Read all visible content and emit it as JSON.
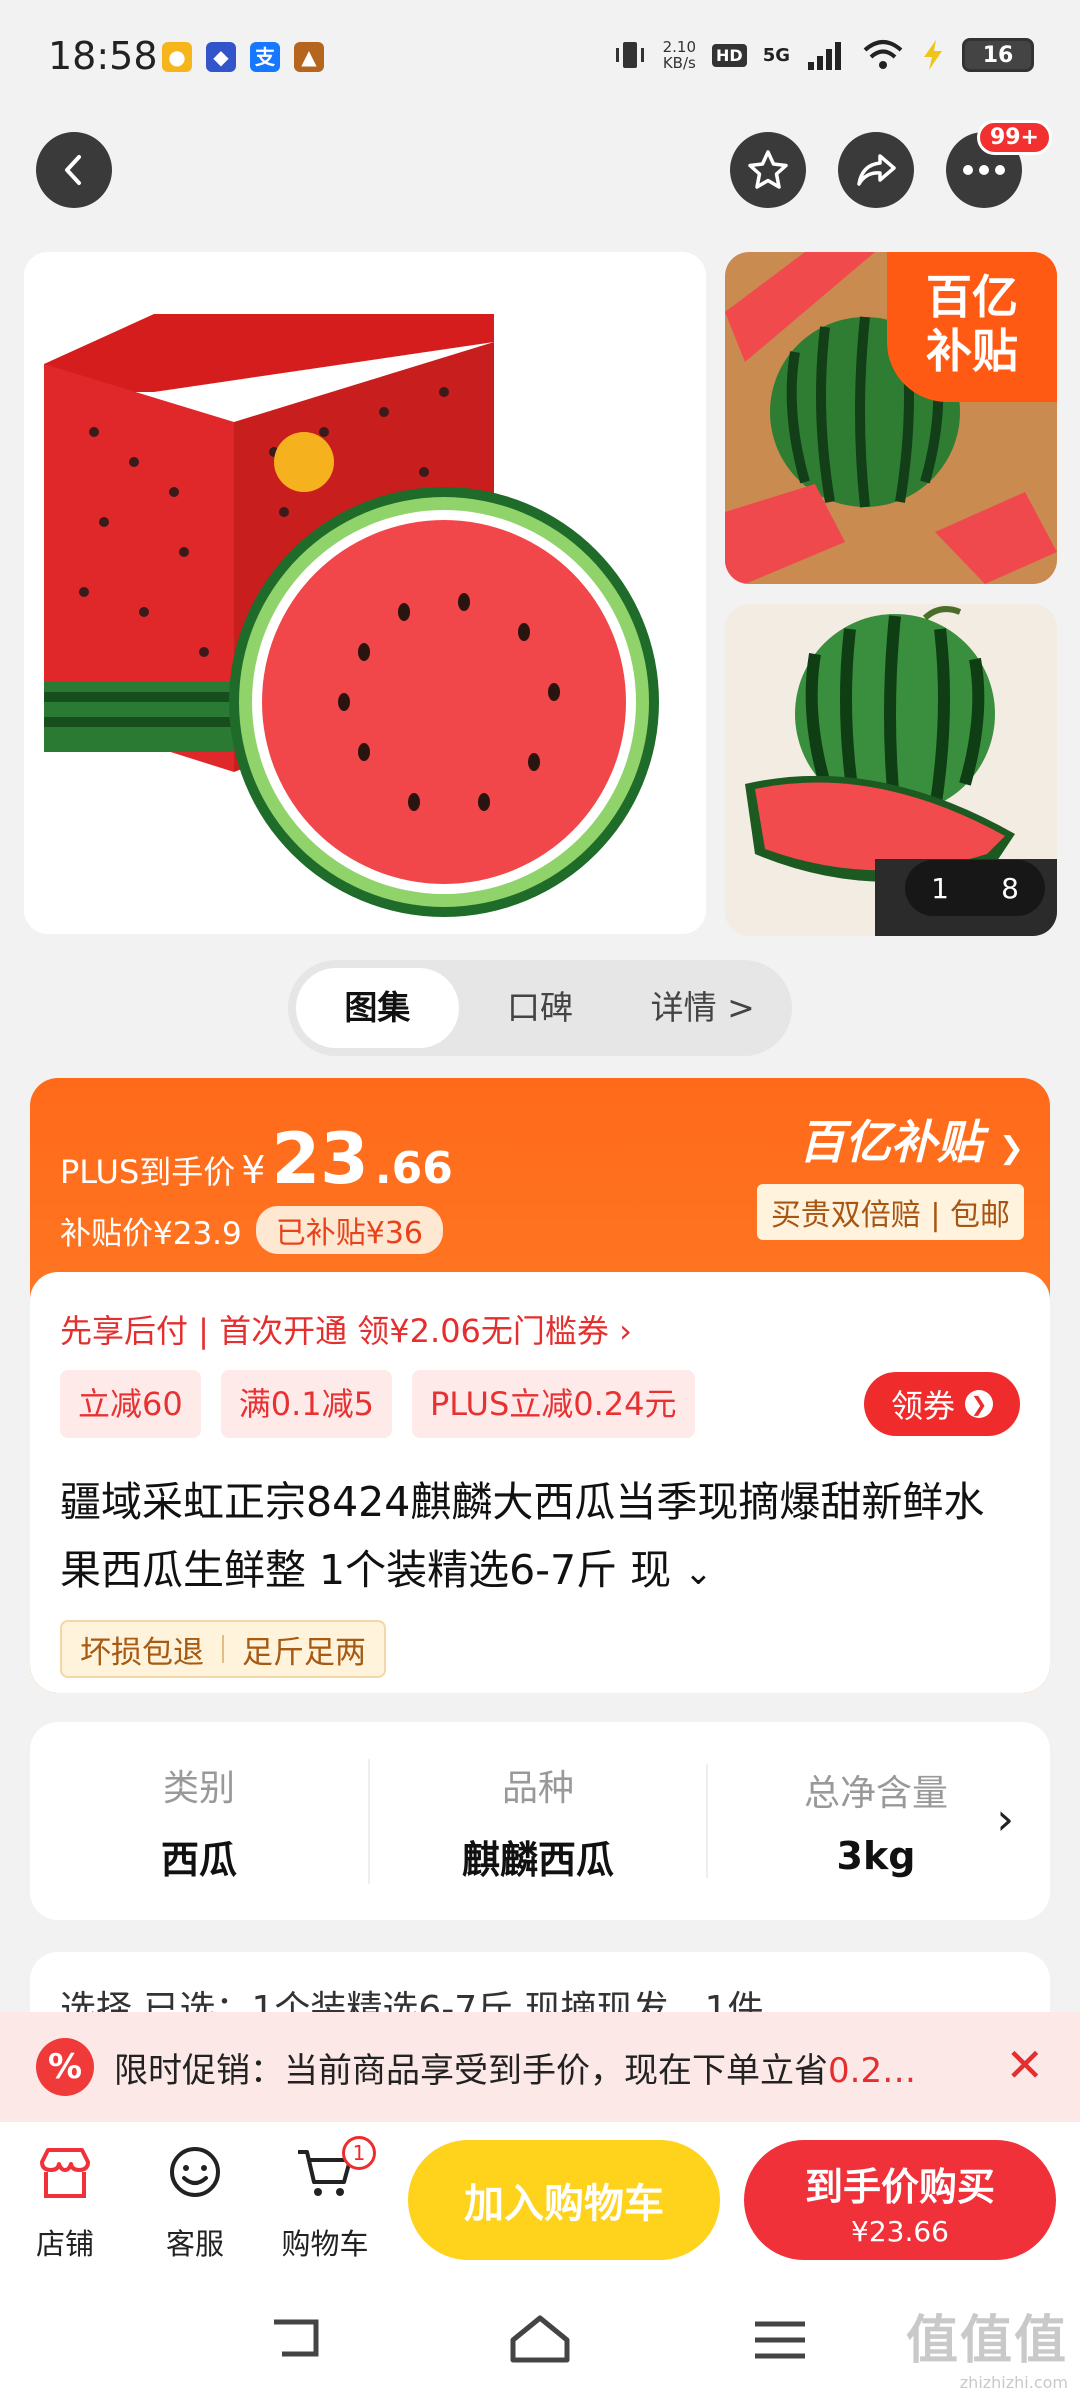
{
  "status_bar": {
    "time": "18:58",
    "app_icons": [
      "swan-app-icon",
      "tieba-app-icon",
      "alipay-app-icon",
      "game-app-icon"
    ],
    "alipay_char": "支",
    "net_speed_value": "2.10",
    "net_speed_unit": "KB/s",
    "hd": "HD",
    "network": "5G",
    "battery": "16"
  },
  "header": {
    "more_badge": "99+"
  },
  "gallery": {
    "subsidy_tag_line1": "百亿",
    "subsidy_tag_line2": "补贴",
    "page_current": "1",
    "page_total": "8"
  },
  "tabs": [
    {
      "label": "图集",
      "active": true
    },
    {
      "label": "口碑",
      "active": false
    },
    {
      "label": "详情 >",
      "active": false
    }
  ],
  "price": {
    "plus_label": "PLUS到手价",
    "yen": "¥",
    "plus_int": "23",
    "plus_dec": ".66",
    "subsidy_price_label": "补贴价¥23.9",
    "subsidized_badge": "已补贴¥36",
    "brand_title": "百亿补贴",
    "brand_sub": "买贵双倍赔 | 包邮"
  },
  "info": {
    "xian_line": "先享后付 | 首次开通 领¥2.06无门槛券 ›",
    "coupons": [
      "立减60",
      "满0.1减5",
      "PLUS立减0.24元"
    ],
    "get_coupon": "领券",
    "title": "疆域采虹正宗8424麒麟大西瓜当季现摘爆甜新鲜水果西瓜生鲜整 1个装精选6-7斤 现",
    "service_tags": [
      "坏损包退",
      "足斤足两"
    ]
  },
  "specs": [
    {
      "label": "类别",
      "value": "西瓜"
    },
    {
      "label": "品种",
      "value": "麒麟西瓜"
    },
    {
      "label": "总净含量",
      "value": "3kg"
    }
  ],
  "selection": {
    "text": "选择    已选：1个装精选6-7斤 现摘现发，1件"
  },
  "promo": {
    "text": "限时促销：当前商品享受到手价，现在下单立省",
    "red_text": "0.2…",
    "icon": "%"
  },
  "bottom_bar": {
    "store": "店铺",
    "service": "客服",
    "cart": "购物车",
    "cart_count": "1",
    "add_to_cart": "加入购物车",
    "buy_label": "到手价购买",
    "buy_price": "¥23.66"
  },
  "watermark": {
    "big": "值值值",
    "small": "zhizhizhi.com"
  },
  "colors": {
    "accent_orange": "#ff6a1a",
    "accent_red": "#f0313a",
    "cart_yellow": "#ffd21c"
  }
}
